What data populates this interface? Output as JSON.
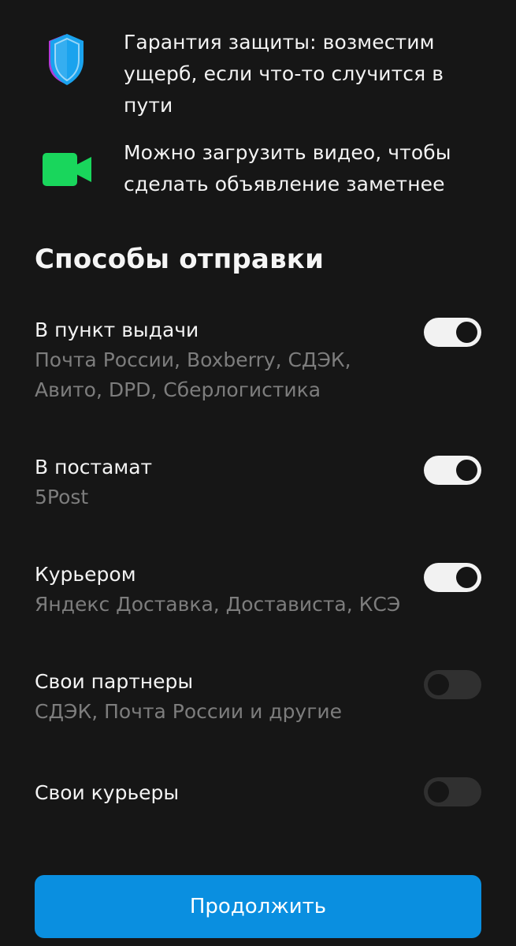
{
  "features": [
    {
      "icon": "shield-icon",
      "text": "Гарантия защиты: возместим ущерб, если что-то случится в пути"
    },
    {
      "icon": "video-camera-icon",
      "text": "Можно загрузить видео, чтобы сделать объявление заметнее"
    }
  ],
  "delivery": {
    "title": "Способы отправки",
    "options": [
      {
        "title": "В пункт выдачи",
        "subtitle": "Почта России, Boxberry, СДЭК, Авито, DPD, Сберлогистика",
        "enabled": true
      },
      {
        "title": "В постамат",
        "subtitle": "5Post",
        "enabled": true
      },
      {
        "title": "Курьером",
        "subtitle": "Яндекс Доставка, Достависта, КСЭ",
        "enabled": true
      },
      {
        "title": "Свои партнеры",
        "subtitle": "СДЭК, Почта России и другие",
        "enabled": false
      },
      {
        "title": "Свои курьеры",
        "subtitle": "",
        "enabled": false
      }
    ]
  },
  "continue_label": "Продолжить",
  "colors": {
    "background": "#161616",
    "accent": "#0a8fe0",
    "shield": "#1aa3ee",
    "video": "#19d65c"
  }
}
